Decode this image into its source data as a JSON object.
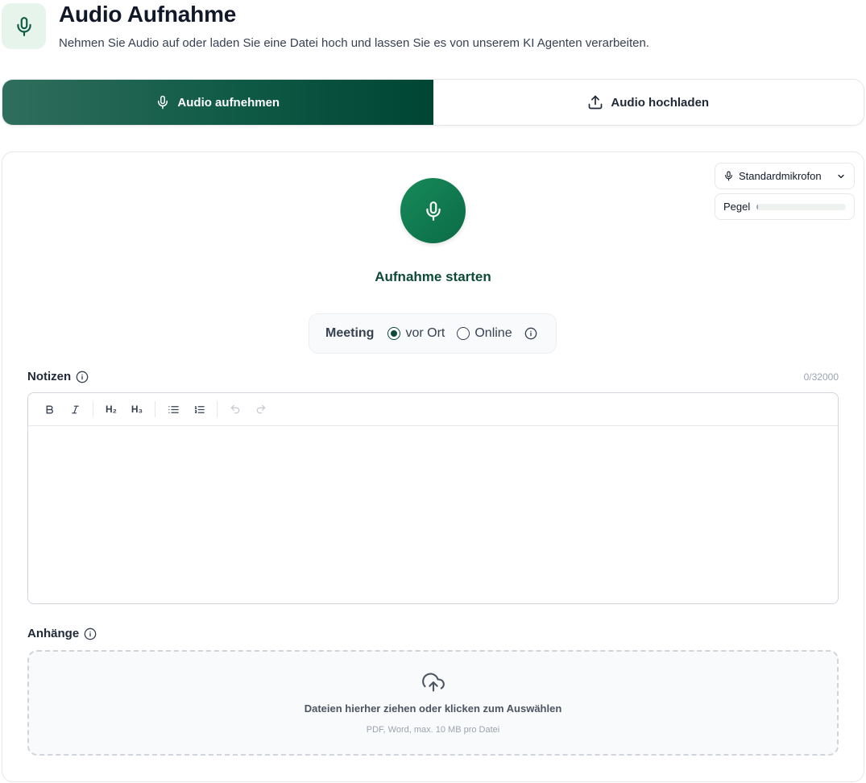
{
  "header": {
    "title": "Audio Aufnahme",
    "subtitle": "Nehmen Sie Audio auf oder laden Sie eine Datei hoch und lassen Sie es von unserem KI Agenten verarbeiten.",
    "icon": "microphone-icon"
  },
  "tabs": [
    {
      "label": "Audio aufnehmen",
      "icon": "microphone-icon",
      "active": true
    },
    {
      "label": "Audio hochladen",
      "icon": "upload-icon",
      "active": false
    }
  ],
  "recorder": {
    "microphone": "Standardmikrofon",
    "level_label": "Pegel",
    "level_value": 0.01,
    "start_label": "Aufnahme starten"
  },
  "meeting": {
    "label": "Meeting",
    "options": [
      {
        "label": "vor Ort",
        "checked": true
      },
      {
        "label": "Online",
        "checked": false
      }
    ]
  },
  "notes": {
    "label": "Notizen",
    "counter": "0/32000",
    "toolbar": {
      "bold": "B",
      "italic": "I",
      "h2": "H₂",
      "h3": "H₃"
    }
  },
  "attachments": {
    "label": "Anhänge",
    "drop_text": "Dateien hierher ziehen oder klicken zum Auswählen",
    "hint": "PDF, Word, max. 10 MB pro Datei"
  },
  "colors": {
    "brand": "#0d4a38",
    "brand_light": "#e6f4ec",
    "record": "#178a5a"
  }
}
